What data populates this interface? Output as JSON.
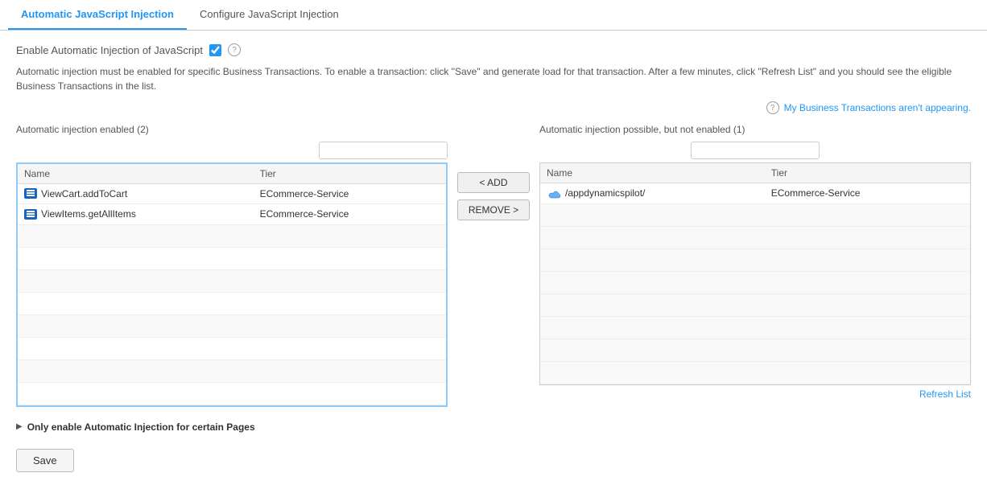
{
  "tabs": [
    {
      "id": "auto-injection",
      "label": "Automatic JavaScript Injection",
      "active": true
    },
    {
      "id": "configure-injection",
      "label": "Configure JavaScript Injection",
      "active": false
    }
  ],
  "enable_section": {
    "label": "Enable Automatic Injection of JavaScript",
    "checked": true
  },
  "info_text": "Automatic injection must be enabled for specific Business Transactions. To enable a transaction: click \"Save\" and generate load for that transaction. After a few minutes, click \"Refresh List\" and you should see the eligible Business Transactions in the list.",
  "help_link": {
    "icon": "?",
    "label": "My Business Transactions aren't appearing."
  },
  "left_panel": {
    "title": "Automatic injection enabled (2)",
    "search_placeholder": "",
    "columns": [
      "Name",
      "Tier"
    ],
    "rows": [
      {
        "icon": "monitor",
        "name": "ViewCart.addToCart",
        "tier": "ECommerce-Service"
      },
      {
        "icon": "monitor",
        "name": "ViewItems.getAllItems",
        "tier": "ECommerce-Service"
      }
    ]
  },
  "right_panel": {
    "title": "Automatic injection possible, but not enabled (1)",
    "search_placeholder": "",
    "columns": [
      "Name",
      "Tier"
    ],
    "rows": [
      {
        "icon": "cloud",
        "name": "/appdynamicspilot/",
        "tier": "ECommerce-Service"
      }
    ]
  },
  "buttons": {
    "add_label": "< ADD",
    "remove_label": "REMOVE >"
  },
  "expand_section": {
    "label": "Only enable Automatic Injection for certain Pages"
  },
  "save_label": "Save",
  "refresh_label": "Refresh List"
}
